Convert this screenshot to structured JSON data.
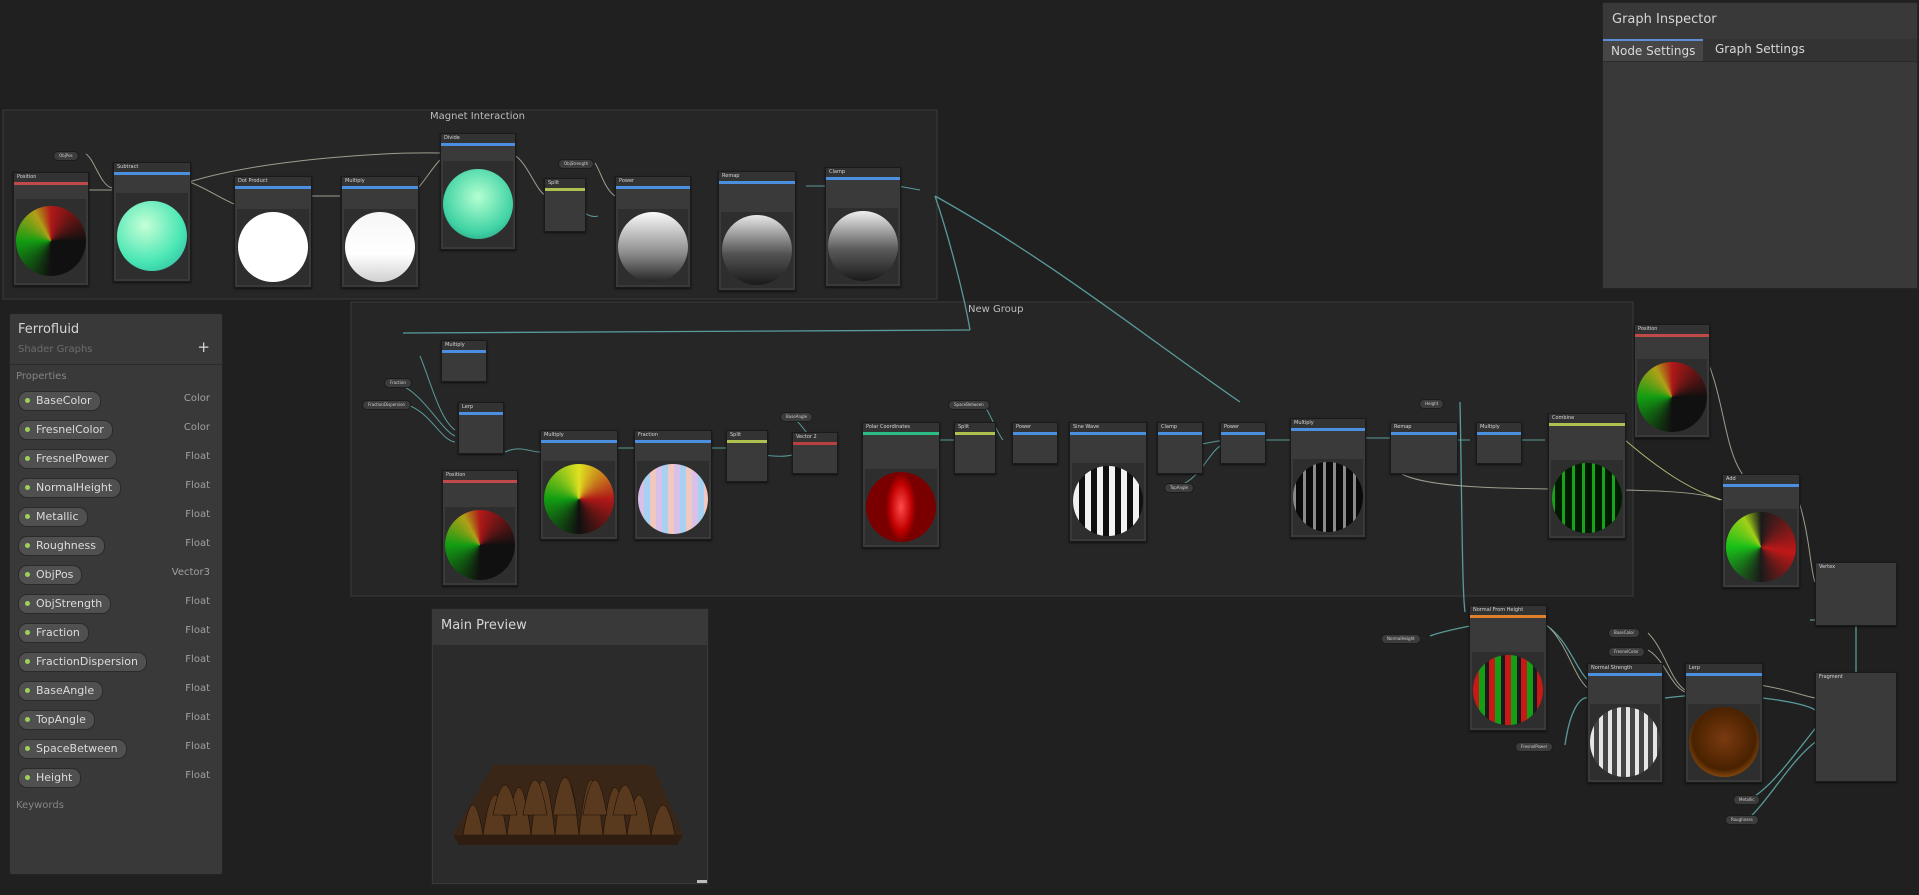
{
  "app": {
    "accent": "#4a8fe0",
    "background": "#202020"
  },
  "groups": {
    "magnet": {
      "title": "Magnet Interaction"
    },
    "newgroup": {
      "title": "New Group"
    }
  },
  "nodes": {
    "position1": "Position",
    "subtract": "Subtract",
    "dot_product": "Dot Product",
    "multiply1": "Multiply",
    "divide": "Divide",
    "split1": "Split",
    "power1": "Power",
    "remap1": "Remap",
    "clamp1": "Clamp",
    "multiply2": "Multiply",
    "lerp1": "Lerp",
    "position2": "Position",
    "multiply3": "Multiply",
    "fraction": "Fraction",
    "split2": "Split",
    "vector2": "Vector 2",
    "polar": "Polar Coordinates",
    "split3": "Split",
    "power2": "Power",
    "sine": "Sine Wave",
    "clamp2": "Clamp",
    "power3": "Power",
    "multiply4": "Multiply",
    "remap2": "Remap",
    "multiply5": "Multiply",
    "combine": "Combine",
    "position3": "Position",
    "add": "Add",
    "vertex": "Vertex",
    "normal_from_height": "Normal From Height",
    "normal_strength": "Normal Strength",
    "lerp2": "Lerp",
    "fragment": "Fragment"
  },
  "property_refs": {
    "objpos": "ObjPos",
    "objstrength": "ObjStrength",
    "fraction": "Fraction",
    "fraction_dispersion": "FractionDispersion",
    "base_angle": "BaseAngle",
    "space_between": "SpaceBetween",
    "top_angle": "TopAngle",
    "height": "Height",
    "normal_height": "NormalHeight",
    "fresnel_power": "FresnelPower",
    "base_color": "BaseColor",
    "fresnel_color": "FresnelColor",
    "metallic": "Metallic",
    "roughness": "Roughness"
  },
  "blackboard": {
    "title": "Ferrofluid",
    "subtitle": "Shader Graphs",
    "add_label": "+",
    "properties_header": "Properties",
    "keywords_header": "Keywords",
    "properties": [
      {
        "name": "BaseColor",
        "type": "Color"
      },
      {
        "name": "FresnelColor",
        "type": "Color"
      },
      {
        "name": "FresnelPower",
        "type": "Float"
      },
      {
        "name": "NormalHeight",
        "type": "Float"
      },
      {
        "name": "Metallic",
        "type": "Float"
      },
      {
        "name": "Roughness",
        "type": "Float"
      },
      {
        "name": "ObjPos",
        "type": "Vector3"
      },
      {
        "name": "ObjStrength",
        "type": "Float"
      },
      {
        "name": "Fraction",
        "type": "Float"
      },
      {
        "name": "FractionDispersion",
        "type": "Float"
      },
      {
        "name": "BaseAngle",
        "type": "Float"
      },
      {
        "name": "TopAngle",
        "type": "Float"
      },
      {
        "name": "SpaceBetween",
        "type": "Float"
      },
      {
        "name": "Height",
        "type": "Float"
      }
    ]
  },
  "inspector": {
    "title": "Graph Inspector",
    "tabs": [
      "Node Settings",
      "Graph Settings"
    ],
    "active_tab": "Node Settings"
  },
  "main_preview": {
    "title": "Main Preview"
  }
}
